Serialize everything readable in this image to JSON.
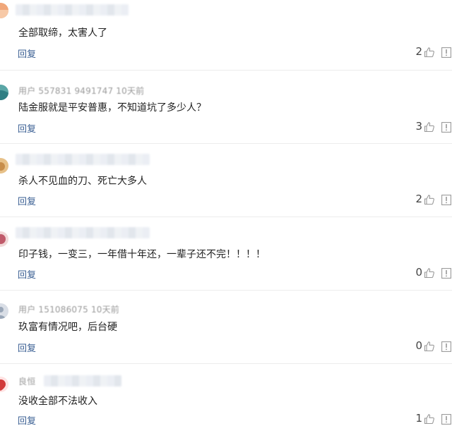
{
  "comments": [
    {
      "text": "全部取缔，太害人了",
      "reply_label": "回复",
      "likes": "2",
      "avatar_color": "#f0a77a",
      "meta_fragment": ""
    },
    {
      "text": "陆金服就是平安普惠，不知道坑了多少人？",
      "reply_label": "回复",
      "likes": "3",
      "avatar_color": "#5aa6a6",
      "meta_fragment": "用户 557831 9491747 10天前"
    },
    {
      "text": "杀人不见血的刀、死亡大多人",
      "reply_label": "回复",
      "likes": "2",
      "avatar_color": "#d8a86a",
      "meta_fragment": ""
    },
    {
      "text": "印子钱，一变三，一年借十年还，一辈子还不完！！！！",
      "reply_label": "回复",
      "likes": "0",
      "avatar_color": "#c05a6a",
      "meta_fragment": ""
    },
    {
      "text": "玖富有情况吧，后台硬",
      "reply_label": "回复",
      "likes": "0",
      "avatar_color": "#9aa7b8",
      "meta_fragment": "用户 151086075 10天前"
    },
    {
      "text": "没收全部不法收入",
      "reply_label": "回复",
      "likes": "1",
      "avatar_color": "#d23a3a",
      "meta_fragment": "良恒"
    }
  ],
  "icons": {
    "like": "thumbs-up-icon",
    "report": "report-icon"
  },
  "colors": {
    "reply_link": "#3a5f93",
    "divider": "#ececec"
  }
}
